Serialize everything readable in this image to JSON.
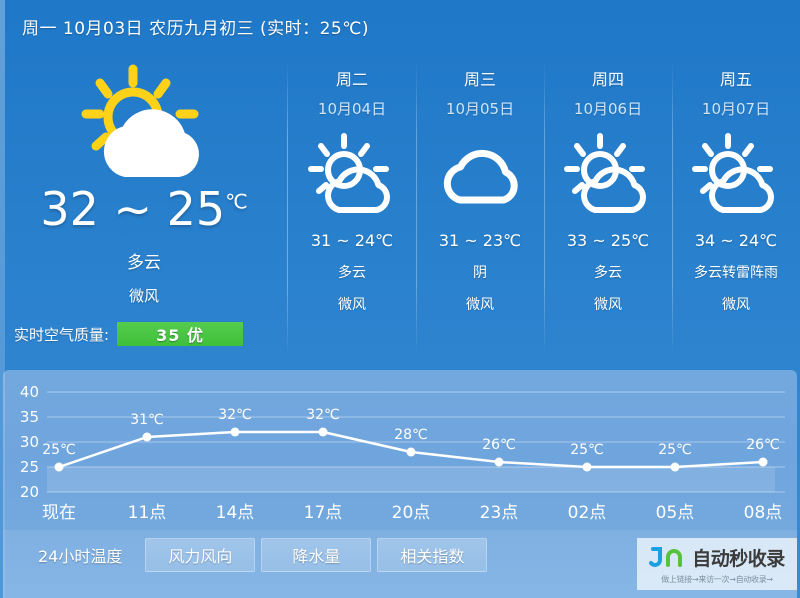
{
  "header": {
    "title": "周一 10月03日 农历九月初三 (实时：25℃)"
  },
  "today": {
    "icon": "sun-behind-cloud-icon",
    "temperature": "32 ~ 25",
    "unit": "℃",
    "condition": "多云",
    "wind": "微风",
    "aqi_label": "实时空气质量:",
    "aqi_value": "35 优",
    "aqi_color": "#44c43e"
  },
  "forecast": [
    {
      "weekday": "周二",
      "date": "10月04日",
      "icon": "sun-behind-cloud-icon",
      "temperature": "31 ~ 24℃",
      "condition": "多云",
      "wind": "微风"
    },
    {
      "weekday": "周三",
      "date": "10月05日",
      "icon": "cloud-icon",
      "temperature": "31 ~ 23℃",
      "condition": "阴",
      "wind": "微风"
    },
    {
      "weekday": "周四",
      "date": "10月06日",
      "icon": "sun-behind-cloud-icon",
      "temperature": "33 ~ 25℃",
      "condition": "多云",
      "wind": "微风"
    },
    {
      "weekday": "周五",
      "date": "10月07日",
      "icon": "sun-behind-cloud-icon",
      "temperature": "34 ~ 24℃",
      "condition": "多云转雷阵雨",
      "wind": "微风"
    }
  ],
  "chart_data": {
    "type": "line",
    "title": "",
    "xlabel": "",
    "ylabel": "",
    "categories": [
      "现在",
      "11点",
      "14点",
      "17点",
      "20点",
      "23点",
      "02点",
      "05点",
      "08点"
    ],
    "values": [
      25,
      31,
      32,
      32,
      28,
      26,
      25,
      25,
      26
    ],
    "point_labels": [
      "25℃",
      "31℃",
      "32℃",
      "32℃",
      "28℃",
      "26℃",
      "25℃",
      "25℃",
      "26℃"
    ],
    "yticks": [
      40,
      35,
      30,
      25,
      20
    ],
    "ylim": [
      20,
      40
    ],
    "grid": true,
    "legend": "none",
    "line_color": "#ffffff",
    "marker_color": "#ffffff"
  },
  "tabs": [
    {
      "label": "24小时温度",
      "active": true
    },
    {
      "label": "风力风向",
      "active": false
    },
    {
      "label": "降水量",
      "active": false
    },
    {
      "label": "相关指数",
      "active": false
    }
  ],
  "watermark": {
    "logo": "jn-logo-icon",
    "text": "自动秒收录",
    "subtext": "做上链接→来访一次→自动收录→"
  }
}
